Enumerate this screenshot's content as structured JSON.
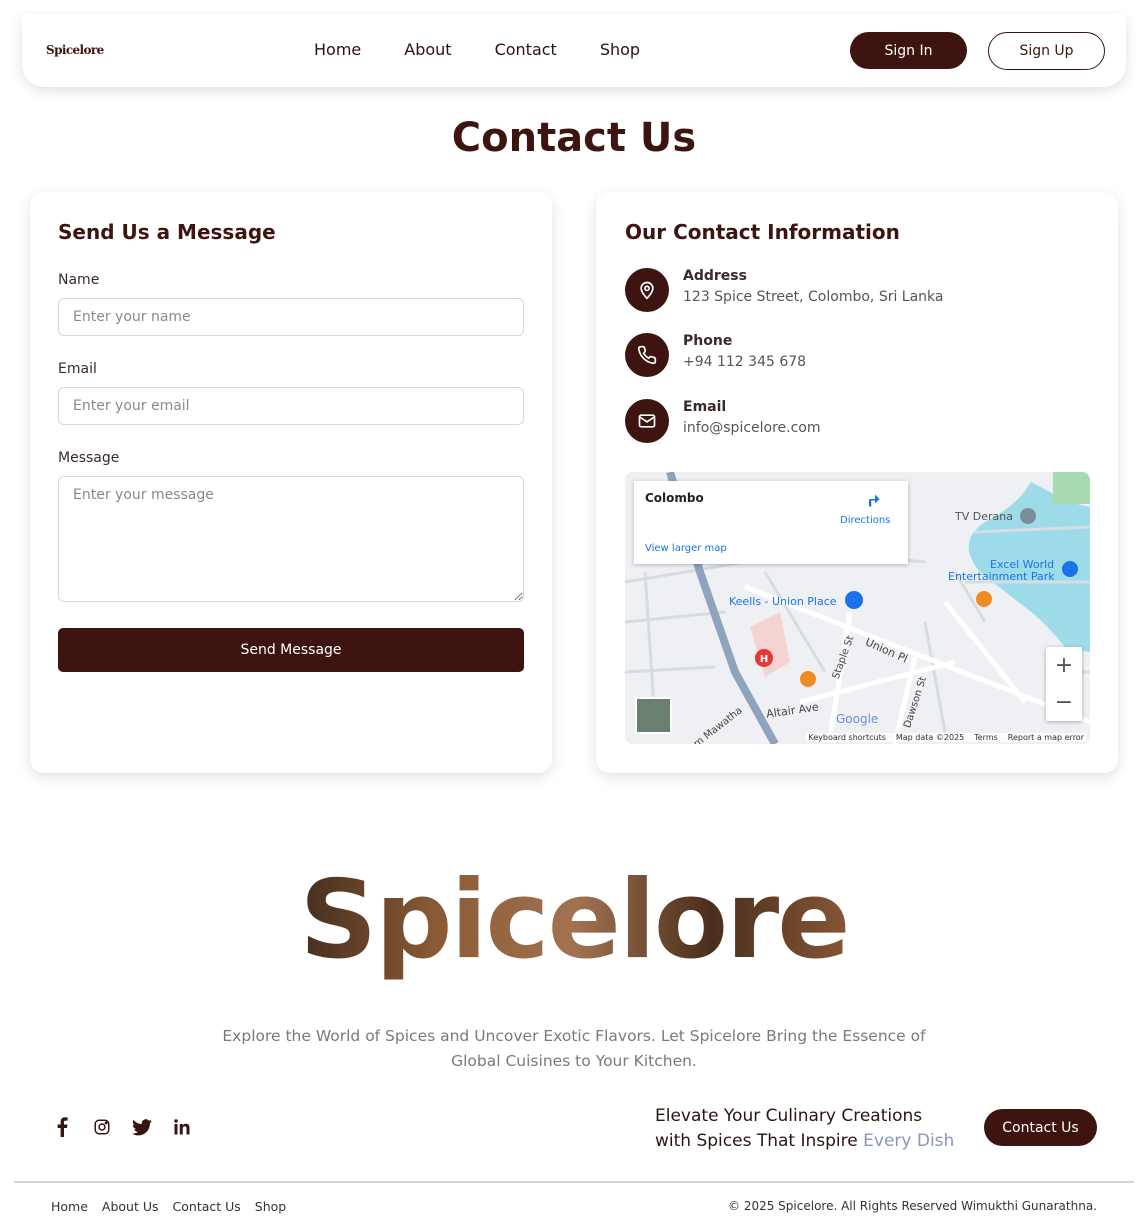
{
  "nav": {
    "logo": "Spicelore",
    "links": [
      "Home",
      "About",
      "Contact",
      "Shop"
    ],
    "signin_label": "Sign In",
    "signup_label": "Sign Up"
  },
  "page_title": "Contact Us",
  "form": {
    "heading": "Send Us a Message",
    "name_label": "Name",
    "name_placeholder": "Enter your name",
    "email_label": "Email",
    "email_placeholder": "Enter your email",
    "message_label": "Message",
    "message_placeholder": "Enter your message",
    "submit_label": "Send Message"
  },
  "contact_info": {
    "heading": "Our Contact Information",
    "address_title": "Address",
    "address_value": "123 Spice Street, Colombo, Sri Lanka",
    "phone_title": "Phone",
    "phone_value": "+94 112 345 678",
    "email_title": "Email",
    "email_value": "info@spicelore.com"
  },
  "map": {
    "city": "Colombo",
    "directions": "Directions",
    "view_larger": "View larger map",
    "labels": {
      "tv_derana": "TV Derana",
      "excel_world": "Excel World",
      "entertainment_park": "Entertainment Park",
      "keells": "Keells - Union Place",
      "union_pl": "Union Pl",
      "staple_st": "Staple St",
      "dawson_st": "Dawson St",
      "altair": "Altair Ave",
      "mawatha": "m Mawatha",
      "google": "Google"
    },
    "footer": [
      "Keyboard shortcuts",
      "Map data ©2025",
      "Terms",
      "Report a map error"
    ]
  },
  "footer": {
    "brand": "Spicelore",
    "tagline": "Explore the World of Spices and Uncover Exotic Flavors. Let Spicelore Bring the Essence of Global Cuisines to Your Kitchen.",
    "cta_line1": "Elevate Your Culinary Creations",
    "cta_line2_prefix": "with Spices That Inspire ",
    "cta_line2_accent": "Every Dish",
    "contact_button": "Contact Us",
    "links": [
      "Home",
      "About Us",
      "Contact Us",
      "Shop"
    ],
    "copyright": "© 2025 Spicelore. All Rights Reserved Wimukthi Gunarathna."
  },
  "colors": {
    "brand_dark": "#3d140f",
    "accent_soft": "#8a96b8",
    "water": "#8fd4e6"
  }
}
